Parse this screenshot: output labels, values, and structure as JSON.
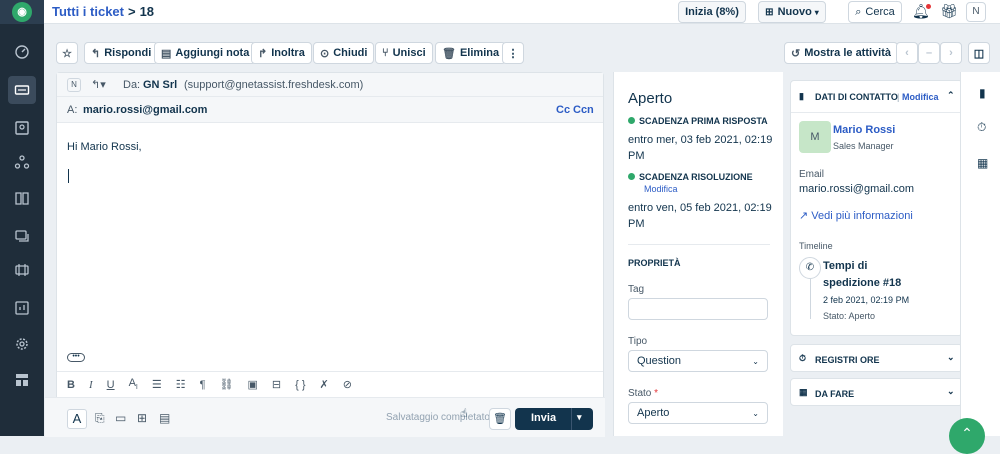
{
  "topbar": {
    "breadcrumb_link": "Tutti i ticket",
    "breadcrumb_sep": ">",
    "ticket_number": "18",
    "start_button": "Inizia (8%)",
    "new_button": "Nuovo",
    "search_label": "Cerca",
    "avatar_initial": "N"
  },
  "toolbar": {
    "reply": "Rispondi",
    "add_note": "Aggiungi nota",
    "forward": "Inoltra",
    "close": "Chiudi",
    "merge": "Unisci",
    "delete": "Elimina",
    "more": "⋮",
    "show_activity": "Mostra le attività"
  },
  "compose": {
    "from_avatar": "N",
    "from_prefix": "Da:",
    "from_name": "GN Srl",
    "from_email": "(support@gnetassist.freshdesk.com)",
    "to_prefix": "A:",
    "to_email": "mario.rossi@gmail.com",
    "cc": "Cc",
    "bcc": "Ccn",
    "greeting": "Hi Mario Rossi,",
    "saving_status": "Salvataggio completato",
    "send_button": "Invia"
  },
  "properties": {
    "status_heading": "Aperto",
    "first_response_label": "SCADENZA PRIMA RISPOSTA",
    "first_response_value": "entro mer, 03 feb 2021, 02:19 PM",
    "resolution_label": "SCADENZA RISOLUZIONE",
    "resolution_edit": "Modifica",
    "resolution_value": "entro ven, 05 feb 2021, 02:19 PM",
    "section_title": "PROPRIETÀ",
    "tag_label": "Tag",
    "type_label": "Tipo",
    "type_value": "Question",
    "state_label": "Stato",
    "state_required": "*",
    "state_value": "Aperto"
  },
  "contact": {
    "header": "DATI DI CONTATTO",
    "edit": "Modifica",
    "avatar_initial": "M",
    "name": "Mario Rossi",
    "role": "Sales Manager",
    "email_label": "Email",
    "email_value": "mario.rossi@gmail.com",
    "more_info": "Vedi più informazioni",
    "timeline_label": "Timeline",
    "timeline_title": "Tempi di spedizione #18",
    "timeline_date": "2 feb 2021, 02:19 PM",
    "timeline_status": "Stato: Aperto",
    "time_logs": "REGISTRI ORE",
    "todo": "DA FARE"
  },
  "colors": {
    "sidebar_bg": "#1f2d3a",
    "accent_blue": "#2c5cc5",
    "send_button_bg": "#12344d",
    "status_green": "#2fa86b",
    "avatar_green": "#c6e6c8"
  }
}
